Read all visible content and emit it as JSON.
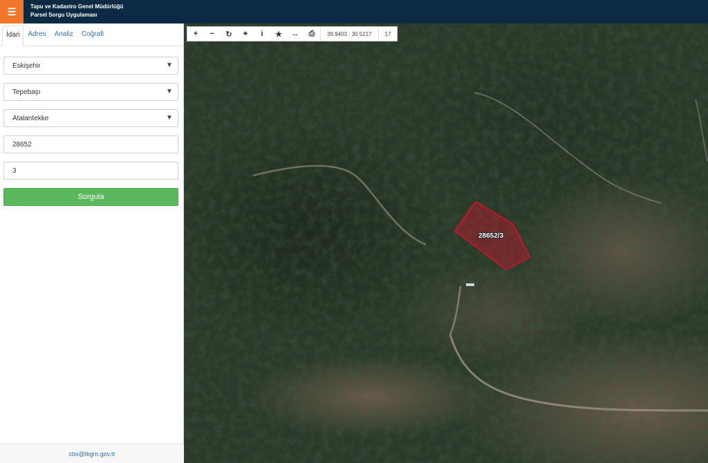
{
  "header": {
    "menu_icon": "☰",
    "title_line1": "Tapu ve Kadastro Genel Müdürlüğü",
    "title_line2": "Parsel Sorgu Uygulaması",
    "background": "#0d2a45",
    "menu_color": "#f0762a"
  },
  "sidebar": {
    "tabs": [
      {
        "label": "İdari",
        "active": true
      },
      {
        "label": "Adres",
        "active": false
      },
      {
        "label": "Analiz",
        "active": false
      },
      {
        "label": "Coğrafi",
        "active": false
      }
    ],
    "fields": {
      "province": "Eskişehir",
      "district": "Tepebaşı",
      "neighborhood": "Atalantekke",
      "block": "28652",
      "parcel": "3"
    },
    "submit_label": "Sorgula",
    "footer_email": "cbs@tkgm.gov.tr"
  },
  "map": {
    "toolbar": [
      {
        "icon": "zoom-in-icon",
        "glyph": "+"
      },
      {
        "icon": "zoom-out-icon",
        "glyph": "−"
      },
      {
        "icon": "refresh-icon",
        "glyph": "↻"
      },
      {
        "icon": "locate-icon",
        "glyph": "⌖"
      },
      {
        "icon": "info-icon",
        "glyph": "i"
      },
      {
        "icon": "star-icon",
        "glyph": "★"
      },
      {
        "icon": "measure-icon",
        "glyph": "↔"
      },
      {
        "icon": "print-icon",
        "glyph": "⎙"
      }
    ],
    "coordinates": "39.9403 : 30.5217",
    "zoom_level": "17",
    "parcel_label": "28652/3",
    "parcel_color": "#c0182a"
  }
}
